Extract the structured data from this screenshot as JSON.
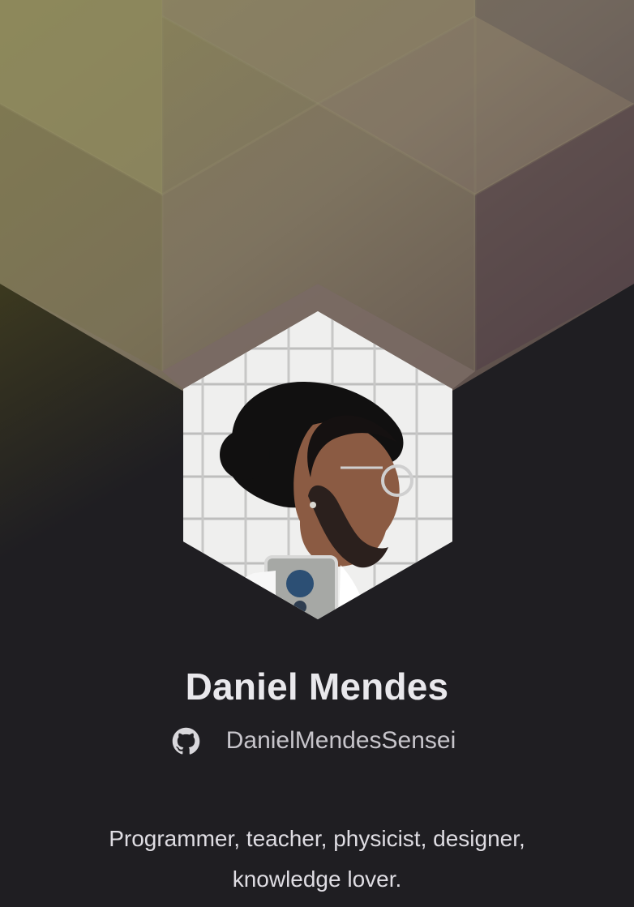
{
  "profile": {
    "name": "Daniel Mendes",
    "github_username": "DanielMendesSensei",
    "bio": "Programmer, teacher, physicist, designer, knowledge lover.",
    "avatar_icon": "profile-photo"
  },
  "theme": {
    "page_background": "#1f1e22",
    "gradient_start": "#8a8557",
    "gradient_end": "#4a3a40",
    "name_color": "#e9e8ec",
    "text_color": "#c7c5cb"
  },
  "icons": {
    "github": "github-icon"
  }
}
